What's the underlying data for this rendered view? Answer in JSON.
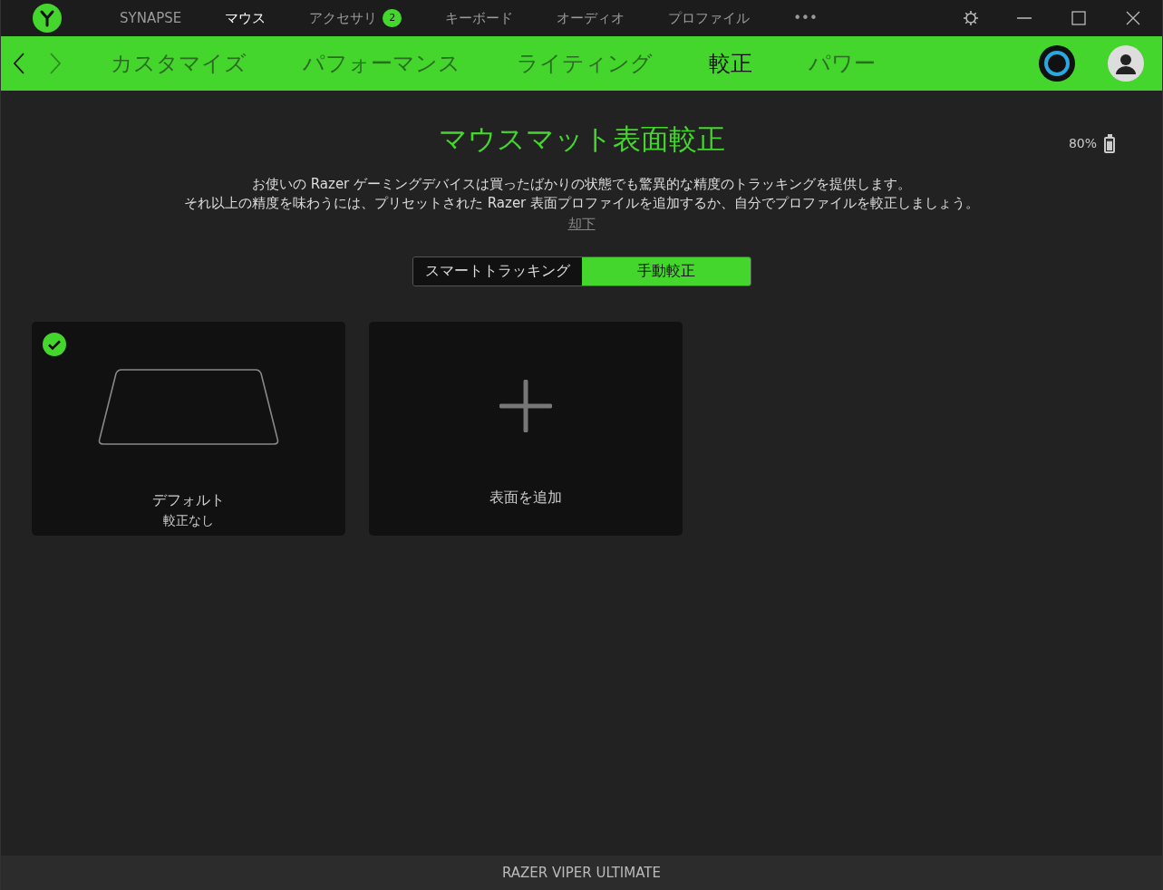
{
  "top_nav": [
    {
      "label": "SYNAPSE",
      "selected": false
    },
    {
      "label": "マウス",
      "selected": true
    },
    {
      "label": "アクセサリ",
      "selected": false,
      "badge": "2"
    },
    {
      "label": "キーボード",
      "selected": false
    },
    {
      "label": "オーディオ",
      "selected": false
    },
    {
      "label": "プロファイル",
      "selected": false
    },
    {
      "label": "•••",
      "selected": false
    }
  ],
  "sub_nav": [
    {
      "label": "カスタマイズ",
      "selected": false
    },
    {
      "label": "パフォーマンス",
      "selected": false
    },
    {
      "label": "ライティング",
      "selected": false
    },
    {
      "label": "較正",
      "selected": true
    },
    {
      "label": "パワー",
      "selected": false
    }
  ],
  "battery": {
    "reading": "80%",
    "level": 0.8
  },
  "title": "マウスマット表面較正",
  "description": [
    "お使いの Razer ゲーミングデバイスは買ったばかりの状態でも驚異的な精度のトラッキングを提供します。",
    "それ以上の精度を味わうには、プリセットされた Razer 表面プロファイルを追加するか、自分でプロファイルを較正しましょう。"
  ],
  "dismiss_link": "却下",
  "mode_toggle": [
    {
      "label": "スマートトラッキング",
      "selected": false
    },
    {
      "label": "手動較正",
      "selected": true
    }
  ],
  "surfaces": [
    {
      "kind": "surface",
      "name": "デフォルト",
      "subtitle": "較正なし",
      "selected": true
    },
    {
      "kind": "add",
      "name": "表面を追加",
      "selected": false
    }
  ],
  "status_bar": "RAZER VIPER ULTIMATE"
}
